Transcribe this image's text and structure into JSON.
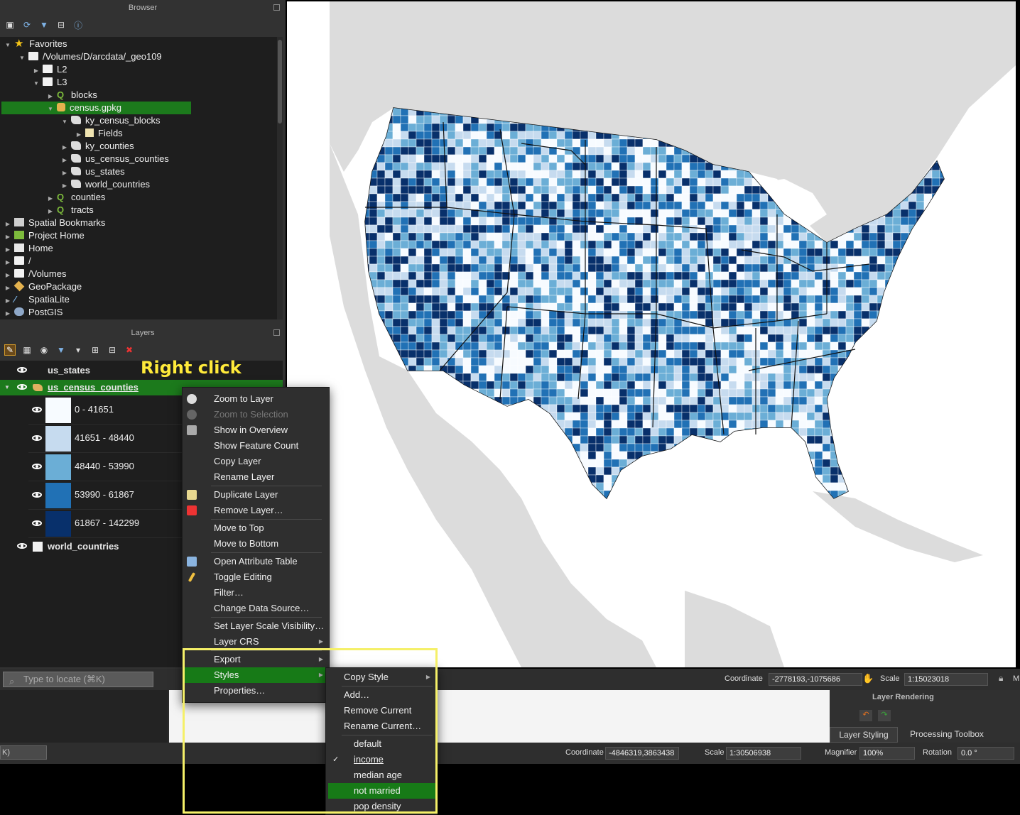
{
  "browser": {
    "title": "Browser",
    "tree": [
      {
        "label": "Favorites",
        "depth": 0,
        "icon": "star-icon",
        "expanded": true
      },
      {
        "label": "/Volumes/D/arcdata/_geo109",
        "depth": 1,
        "icon": "folder-icon",
        "expanded": true
      },
      {
        "label": "L2",
        "depth": 2,
        "icon": "folder-icon",
        "expanded": false
      },
      {
        "label": "L3",
        "depth": 2,
        "icon": "folder-icon",
        "expanded": true
      },
      {
        "label": "blocks",
        "depth": 3,
        "icon": "qgis-project-icon",
        "expanded": false
      },
      {
        "label": "census.gpkg",
        "depth": 3,
        "icon": "geopackage-db-icon",
        "expanded": true,
        "selected": true
      },
      {
        "label": "ky_census_blocks",
        "depth": 4,
        "icon": "polygon-layer-icon",
        "expanded": true
      },
      {
        "label": "Fields",
        "depth": 5,
        "icon": "fields-icon",
        "expanded": false
      },
      {
        "label": "ky_counties",
        "depth": 4,
        "icon": "polygon-layer-icon",
        "expanded": false
      },
      {
        "label": "us_census_counties",
        "depth": 4,
        "icon": "polygon-layer-icon",
        "expanded": false
      },
      {
        "label": "us_states",
        "depth": 4,
        "icon": "polygon-layer-icon",
        "expanded": false
      },
      {
        "label": "world_countries",
        "depth": 4,
        "icon": "polygon-layer-icon",
        "expanded": false
      },
      {
        "label": "counties",
        "depth": 3,
        "icon": "qgis-project-icon",
        "expanded": false
      },
      {
        "label": "tracts",
        "depth": 3,
        "icon": "qgis-project-icon",
        "expanded": false
      },
      {
        "label": "Spatial Bookmarks",
        "depth": 0,
        "icon": "bookmarks-icon",
        "expanded": false
      },
      {
        "label": "Project Home",
        "depth": 0,
        "icon": "project-home-icon",
        "expanded": false
      },
      {
        "label": "Home",
        "depth": 0,
        "icon": "home-icon",
        "expanded": false
      },
      {
        "label": "/",
        "depth": 0,
        "icon": "folder-icon",
        "expanded": false
      },
      {
        "label": "/Volumes",
        "depth": 0,
        "icon": "folder-icon",
        "expanded": false
      },
      {
        "label": "GeoPackage",
        "depth": 0,
        "icon": "geopackage-icon",
        "expanded": false
      },
      {
        "label": "SpatiaLite",
        "depth": 0,
        "icon": "spatialite-icon",
        "expanded": false
      },
      {
        "label": "PostGIS",
        "depth": 0,
        "icon": "postgis-icon",
        "expanded": false
      }
    ]
  },
  "layers": {
    "title": "Layers",
    "us_states": "us_states",
    "us_census_counties": "us_census_counties",
    "world_countries": "world_countries",
    "classes": [
      {
        "label": "0 - 41651",
        "color": "#f7fbff"
      },
      {
        "label": "41651 - 48440",
        "color": "#c6dbef"
      },
      {
        "label": "48440 - 53990",
        "color": "#6baed6"
      },
      {
        "label": "53990 - 61867",
        "color": "#2171b5"
      },
      {
        "label": "61867 - 142299",
        "color": "#08306b"
      }
    ]
  },
  "annotation": "Right click",
  "locate_placeholder": "Type to locate (⌘K)",
  "status": {
    "coordinate_label": "Coordinate",
    "coordinate": "-2778193,-1075686",
    "scale_label": "Scale",
    "scale": "1:15023018",
    "m": "M"
  },
  "under_status": {
    "coordinate_label": "Coordinate",
    "coordinate": "-4846319,3863438",
    "scale_label": "Scale",
    "scale": "1:30506938",
    "magnifier_label": "Magnifier",
    "magnifier": "100%",
    "rotation_label": "Rotation",
    "rotation": "0.0 °",
    "layer_rendering": "Layer Rendering",
    "tab_styling": "Layer Styling",
    "tab_processing": "Processing Toolbox",
    "left_stub": "K)"
  },
  "context_menu": [
    {
      "label": "Zoom to Layer",
      "icon": "zoom-layer-icon"
    },
    {
      "label": "Zoom to Selection",
      "icon": "zoom-selection-icon",
      "disabled": true
    },
    {
      "label": "Show in Overview",
      "icon": "overview-icon"
    },
    {
      "label": "Show Feature Count"
    },
    {
      "label": "Copy Layer"
    },
    {
      "label": "Rename Layer"
    },
    {
      "label": "Duplicate Layer",
      "icon": "duplicate-icon"
    },
    {
      "label": "Remove Layer…",
      "icon": "remove-icon"
    },
    {
      "label": "Move to Top"
    },
    {
      "label": "Move to Bottom"
    },
    {
      "label": "Open Attribute Table",
      "icon": "table-icon"
    },
    {
      "label": "Toggle Editing",
      "icon": "pencil-icon"
    },
    {
      "label": "Filter…"
    },
    {
      "label": "Change Data Source…"
    },
    {
      "label": "Set Layer Scale Visibility…"
    },
    {
      "label": "Layer CRS",
      "submenu": true
    },
    {
      "label": "Export",
      "submenu": true
    },
    {
      "label": "Styles",
      "submenu": true,
      "highlighted": true
    },
    {
      "label": "Properties…"
    }
  ],
  "styles_menu": [
    {
      "label": "Copy Style",
      "submenu": true
    },
    {
      "label": "Add…"
    },
    {
      "label": "Remove Current"
    },
    {
      "label": "Rename Current…"
    },
    {
      "label": "default"
    },
    {
      "label": "income",
      "checked": true
    },
    {
      "label": "median age"
    },
    {
      "label": "not married",
      "highlighted": true
    },
    {
      "label": "pop density"
    }
  ],
  "colors": {
    "selection": "#177a17",
    "annotation": "#ffea3a",
    "highlight_box": "#f5f068"
  }
}
